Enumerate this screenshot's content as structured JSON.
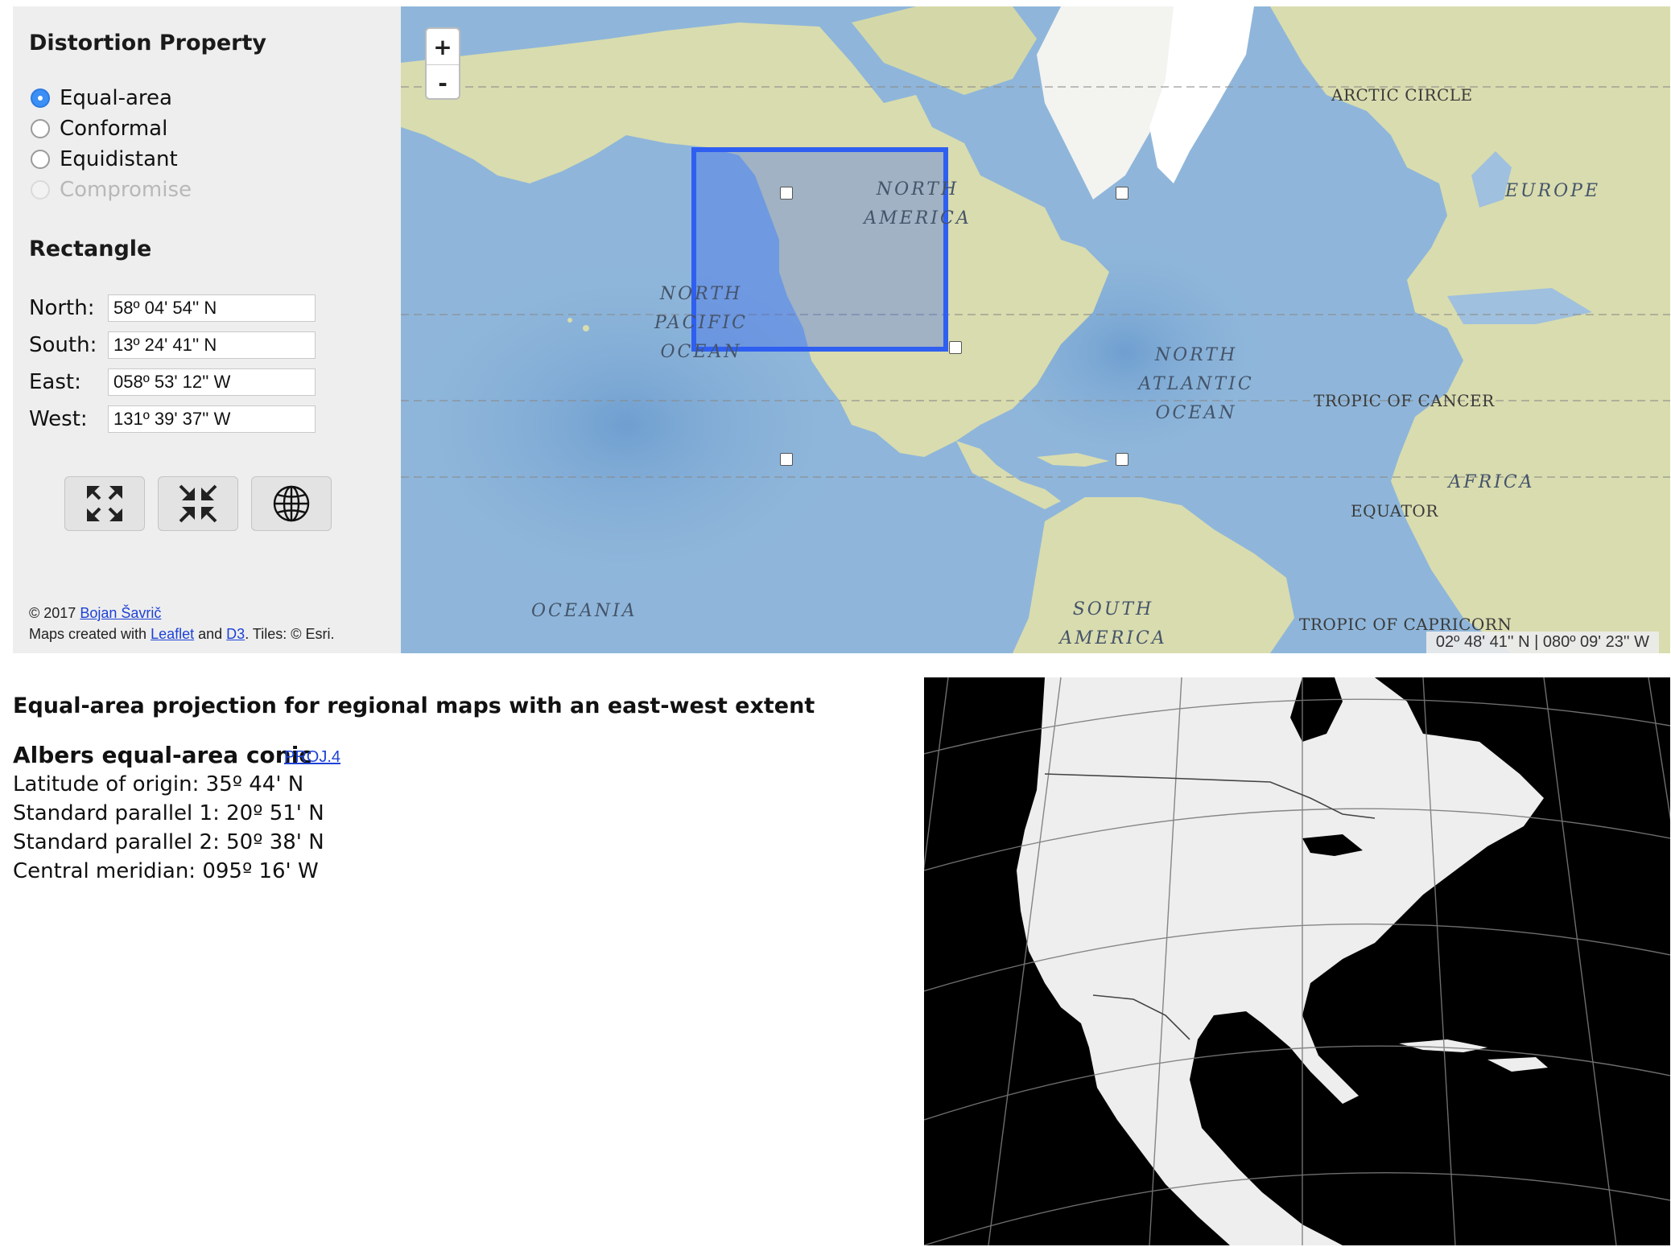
{
  "panel": {
    "distortion_title": "Distortion Property",
    "options": [
      {
        "label": "Equal-area",
        "checked": true,
        "disabled": false
      },
      {
        "label": "Conformal",
        "checked": false,
        "disabled": false
      },
      {
        "label": "Equidistant",
        "checked": false,
        "disabled": false
      },
      {
        "label": "Compromise",
        "checked": false,
        "disabled": true
      }
    ],
    "rectangle_title": "Rectangle",
    "north_label": "North:",
    "north_value": "58º 04' 54'' N",
    "south_label": "South:",
    "south_value": "13º 24' 41'' N",
    "east_label": "East:",
    "east_value": "058º 53' 12'' W",
    "west_label": "West:",
    "west_value": "131º 39' 37'' W",
    "buttons": [
      {
        "icon": "expand-arrows-icon"
      },
      {
        "icon": "collapse-arrows-icon"
      },
      {
        "icon": "globe-icon"
      }
    ],
    "credits": {
      "copyright": "© 2017 ",
      "author": "Bojan Šavrič",
      "made_with": "Maps created with ",
      "leaflet": "Leaflet",
      "and": " and ",
      "d3": "D3",
      "tiles": ". Tiles: © Esri."
    }
  },
  "map": {
    "zoom_in": "+",
    "zoom_out": "-",
    "labels": {
      "north_america": "NORTH AMERICA",
      "north_pacific": "NORTH PACIFIC OCEAN",
      "north_atlantic": "NORTH ATLANTIC OCEAN",
      "europe": "EUROPE",
      "africa": "AFRICA",
      "south_america": "SOUTH AMERICA",
      "oceania": "OCEANIA",
      "arctic_circle": "ARCTIC CIRCLE",
      "tropic_cancer": "TROPIC OF CANCER",
      "equator": "EQUATOR",
      "tropic_capricorn": "TROPIC OF CAPRICORN"
    },
    "cursor_readout": "02º 48' 41'' N | 080º 09' 23'' W",
    "colors": {
      "ocean": "#8fb6da",
      "land": "#d9dcae",
      "selection": "#2f5ff0"
    }
  },
  "result": {
    "heading": "Equal-area projection for regional maps with an east-west extent",
    "projection_name": "Albers equal-area conic",
    "proj_link": "PROJ.4",
    "latitude_origin": "Latitude of origin: 35º 44' N",
    "standard_parallel_1": "Standard parallel 1: 20º 51' N",
    "standard_parallel_2": "Standard parallel 2: 50º 38' N",
    "central_meridian": "Central meridian: 095º 16' W"
  }
}
